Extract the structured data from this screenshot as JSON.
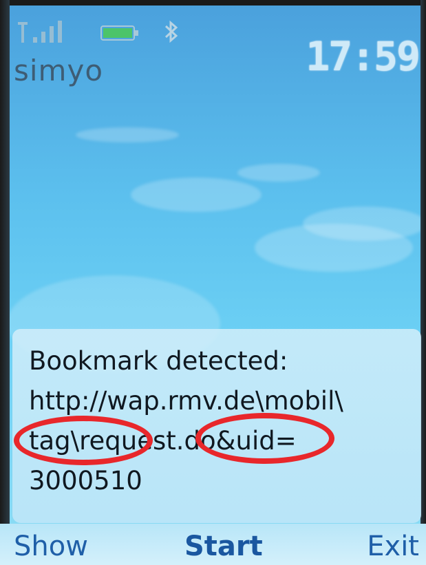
{
  "status": {
    "operator": "simyo",
    "time": "17:59",
    "signal_icon": "signal-bars-icon",
    "battery_icon": "battery-icon",
    "bluetooth_icon": "bluetooth-icon"
  },
  "dialog": {
    "lines": [
      "Bookmark detected:",
      "http://wap.rmv.de\\mobil\\",
      "tag\\request.do&uid=",
      "3000510"
    ]
  },
  "softkeys": {
    "left": "Show",
    "center": "Start",
    "right": "Exit"
  },
  "colors": {
    "annotation": "#e8272b",
    "softkey_text": "#1f5fa8"
  }
}
